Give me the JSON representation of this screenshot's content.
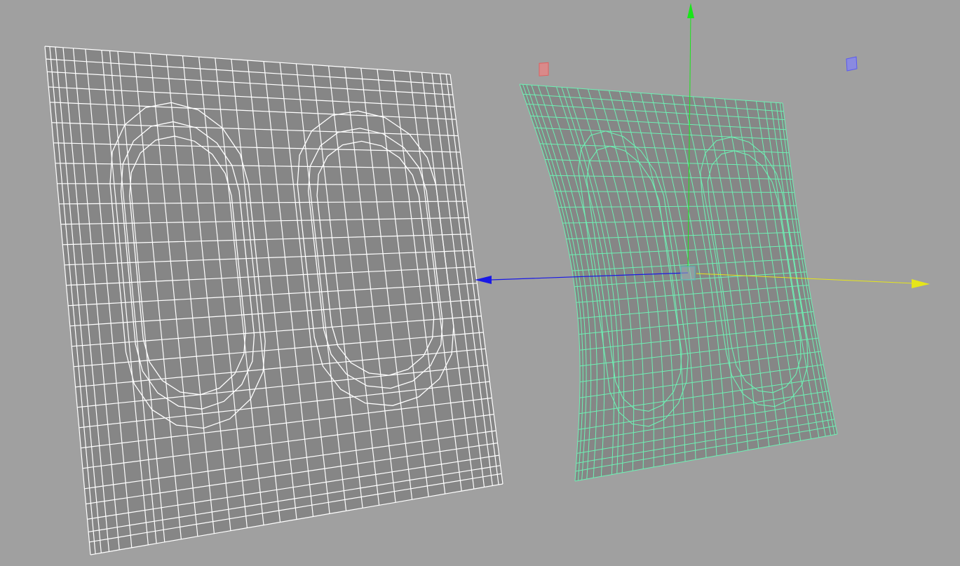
{
  "viewport": {
    "background": "#a0a0a0",
    "interaction_note": ""
  },
  "meshes": [
    {
      "id": "flat-plane",
      "state": "unselected",
      "wire_color": "#ffffff",
      "face_color": "#868686",
      "features": [
        "rounded-hole-left",
        "rounded-hole-right"
      ]
    },
    {
      "id": "bent-plane",
      "state": "selected",
      "wire_color": "#6ef0b4",
      "face_color": "#868686",
      "features": [
        "rounded-hole-left",
        "rounded-hole-right"
      ]
    }
  ],
  "manipulator": {
    "type": "move-gizmo",
    "axes": [
      {
        "name": "y-axis",
        "color": "#19e619"
      },
      {
        "name": "z-axis",
        "color": "#1919e6"
      },
      {
        "name": "x-axis",
        "color": "#e6e619"
      }
    ],
    "center_handle_color": "#5ab4b4"
  },
  "handles": [
    {
      "name": "deformer-handle-red",
      "color": "#e06060"
    },
    {
      "name": "deformer-handle-blue",
      "color": "#7070f0"
    }
  ]
}
